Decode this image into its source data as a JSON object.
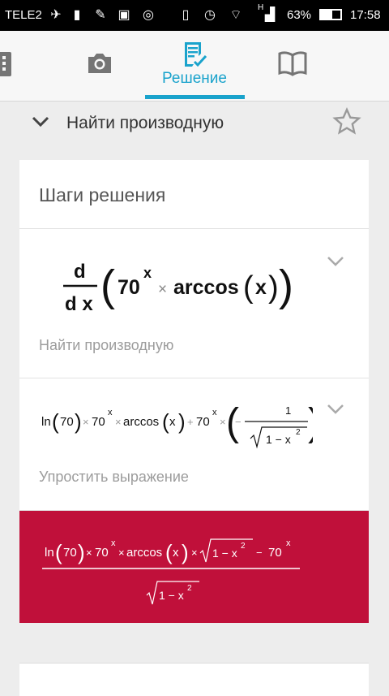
{
  "status_bar": {
    "carrier": "TELE2",
    "network": "H",
    "battery": "63%",
    "time": "17:58"
  },
  "toolbar": {
    "active_tab": "Решение",
    "tabs": [
      "calculator-icon",
      "camera-icon",
      "solution-icon",
      "book-icon"
    ]
  },
  "header": {
    "title": "Найти производную"
  },
  "card": {
    "title": "Шаги решения",
    "steps": [
      {
        "label": "Найти производную",
        "expr": {
          "d": "d",
          "dx": "d x",
          "base": "70",
          "exp": "x",
          "times": "×",
          "func": "arccos",
          "arg": "x"
        }
      },
      {
        "label": "Упростить выражение",
        "expr": {
          "ln": "ln",
          "ln_arg": "70",
          "times": "×",
          "base": "70",
          "exp": "x",
          "func": "arccos",
          "arg": "x",
          "plus": "+",
          "minus": "−",
          "num": "1",
          "rad_a": "1 − x",
          "rad_exp": "2"
        }
      }
    ],
    "result": {
      "ln": "ln",
      "ln_arg": "70",
      "times": "×",
      "base": "70",
      "exp": "x",
      "func": "arccos",
      "arg": "x",
      "rad_a": "1 − x",
      "rad_exp": "2",
      "minus": "−"
    }
  },
  "colors": {
    "accent": "#1aa3cc",
    "result_bg": "#c0103a"
  }
}
